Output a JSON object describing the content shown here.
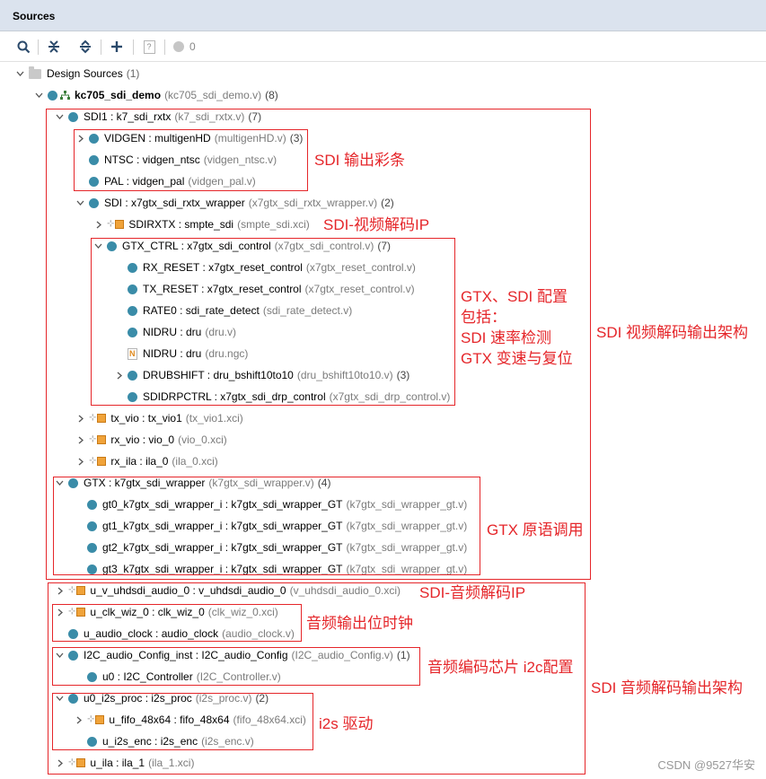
{
  "panel": {
    "title": "Sources"
  },
  "toolbar": {
    "search": "search-icon",
    "collapse_all": "collapse-all-icon",
    "expand_all": "expand-all-icon",
    "add": "add-icon",
    "help": "?",
    "status_count": "0"
  },
  "tree": [
    {
      "id": "design-sources",
      "name": "Design Sources",
      "count": "(1)",
      "expand": "open",
      "icon": "folder"
    },
    {
      "id": "kc705",
      "name": "kc705_sdi_demo",
      "file": "(kc705_sdi_demo.v)",
      "count": "(8)",
      "expand": "open",
      "icon": "dot-hier",
      "bold": true
    },
    {
      "id": "sdi1",
      "name": "SDI1 : k7_sdi_rxtx",
      "file": "(k7_sdi_rxtx.v)",
      "count": "(7)",
      "expand": "open",
      "icon": "dot"
    },
    {
      "id": "vidgen",
      "name": "VIDGEN : multigenHD",
      "file": "(multigenHD.v)",
      "count": "(3)",
      "expand": "closed",
      "icon": "dot"
    },
    {
      "id": "ntsc",
      "name": "NTSC : vidgen_ntsc",
      "file": "(vidgen_ntsc.v)",
      "count": "",
      "expand": "none",
      "icon": "dot"
    },
    {
      "id": "pal",
      "name": "PAL : vidgen_pal",
      "file": "(vidgen_pal.v)",
      "count": "",
      "expand": "none",
      "icon": "dot"
    },
    {
      "id": "sdi",
      "name": "SDI : x7gtx_sdi_rxtx_wrapper",
      "file": "(x7gtx_sdi_rxtx_wrapper.v)",
      "count": "(2)",
      "expand": "open",
      "icon": "dot"
    },
    {
      "id": "sdirxtx",
      "name": "SDIRXTX : smpte_sdi",
      "file": "(smpte_sdi.xci)",
      "count": "",
      "expand": "closed",
      "icon": "ip"
    },
    {
      "id": "gtxctrl",
      "name": "GTX_CTRL : x7gtx_sdi_control",
      "file": "(x7gtx_sdi_control.v)",
      "count": "(7)",
      "expand": "open",
      "icon": "dot"
    },
    {
      "id": "rxreset",
      "name": "RX_RESET : x7gtx_reset_control",
      "file": "(x7gtx_reset_control.v)",
      "count": "",
      "expand": "none",
      "icon": "dot"
    },
    {
      "id": "txreset",
      "name": "TX_RESET : x7gtx_reset_control",
      "file": "(x7gtx_reset_control.v)",
      "count": "",
      "expand": "none",
      "icon": "dot"
    },
    {
      "id": "rate0",
      "name": "RATE0 : sdi_rate_detect",
      "file": "(sdi_rate_detect.v)",
      "count": "",
      "expand": "none",
      "icon": "dot"
    },
    {
      "id": "nidru1",
      "name": "NIDRU : dru",
      "file": "(dru.v)",
      "count": "",
      "expand": "none",
      "icon": "dot"
    },
    {
      "id": "nidru2",
      "name": "NIDRU : dru",
      "file": "(dru.ngc)",
      "count": "",
      "expand": "none",
      "icon": "ngc"
    },
    {
      "id": "drubshift",
      "name": "DRUBSHIFT : dru_bshift10to10",
      "file": "(dru_bshift10to10.v)",
      "count": "(3)",
      "expand": "closed",
      "icon": "dot"
    },
    {
      "id": "sdidrp",
      "name": "SDIDRPCTRL : x7gtx_sdi_drp_control",
      "file": "(x7gtx_sdi_drp_control.v)",
      "count": "",
      "expand": "none",
      "icon": "dot"
    },
    {
      "id": "txvio",
      "name": "tx_vio : tx_vio1",
      "file": "(tx_vio1.xci)",
      "count": "",
      "expand": "closed",
      "icon": "ip"
    },
    {
      "id": "rxvio",
      "name": "rx_vio : vio_0",
      "file": "(vio_0.xci)",
      "count": "",
      "expand": "closed",
      "icon": "ip"
    },
    {
      "id": "rxila",
      "name": "rx_ila : ila_0",
      "file": "(ila_0.xci)",
      "count": "",
      "expand": "closed",
      "icon": "ip"
    },
    {
      "id": "gtx",
      "name": "GTX : k7gtx_sdi_wrapper",
      "file": "(k7gtx_sdi_wrapper.v)",
      "count": "(4)",
      "expand": "open",
      "icon": "dot"
    },
    {
      "id": "gt0",
      "name": "gt0_k7gtx_sdi_wrapper_i : k7gtx_sdi_wrapper_GT",
      "file": "(k7gtx_sdi_wrapper_gt.v)",
      "count": "",
      "expand": "none",
      "icon": "dot"
    },
    {
      "id": "gt1",
      "name": "gt1_k7gtx_sdi_wrapper_i : k7gtx_sdi_wrapper_GT",
      "file": "(k7gtx_sdi_wrapper_gt.v)",
      "count": "",
      "expand": "none",
      "icon": "dot"
    },
    {
      "id": "gt2",
      "name": "gt2_k7gtx_sdi_wrapper_i : k7gtx_sdi_wrapper_GT",
      "file": "(k7gtx_sdi_wrapper_gt.v)",
      "count": "",
      "expand": "none",
      "icon": "dot"
    },
    {
      "id": "gt3",
      "name": "gt3_k7gtx_sdi_wrapper_i : k7gtx_sdi_wrapper_GT",
      "file": "(k7gtx_sdi_wrapper_gt.v)",
      "count": "",
      "expand": "none",
      "icon": "dot"
    },
    {
      "id": "uhdsdi",
      "name": "u_v_uhdsdi_audio_0 : v_uhdsdi_audio_0",
      "file": "(v_uhdsdi_audio_0.xci)",
      "count": "",
      "expand": "closed",
      "icon": "ip"
    },
    {
      "id": "clkwiz",
      "name": "u_clk_wiz_0 : clk_wiz_0",
      "file": "(clk_wiz_0.xci)",
      "count": "",
      "expand": "closed",
      "icon": "ip"
    },
    {
      "id": "audioclk",
      "name": "u_audio_clock : audio_clock",
      "file": "(audio_clock.v)",
      "count": "",
      "expand": "none",
      "icon": "dot"
    },
    {
      "id": "i2ccfg",
      "name": "I2C_audio_Config_inst : I2C_audio_Config",
      "file": "(I2C_audio_Config.v)",
      "count": "(1)",
      "expand": "open",
      "icon": "dot"
    },
    {
      "id": "i2cctrl",
      "name": "u0 : I2C_Controller",
      "file": "(I2C_Controller.v)",
      "count": "",
      "expand": "none",
      "icon": "dot"
    },
    {
      "id": "i2sproc",
      "name": "u0_i2s_proc : i2s_proc",
      "file": "(i2s_proc.v)",
      "count": "(2)",
      "expand": "open",
      "icon": "dot"
    },
    {
      "id": "fifo",
      "name": "u_fifo_48x64 : fifo_48x64",
      "file": "(fifo_48x64.xci)",
      "count": "",
      "expand": "closed",
      "icon": "ip"
    },
    {
      "id": "i2senc",
      "name": "u_i2s_enc : i2s_enc",
      "file": "(i2s_enc.v)",
      "count": "",
      "expand": "none",
      "icon": "dot"
    },
    {
      "id": "uila",
      "name": "u_ila : ila_1",
      "file": "(ila_1.xci)",
      "count": "",
      "expand": "closed",
      "icon": "ip"
    }
  ],
  "annotations": {
    "sdi_colorbar": "SDI 输出彩条",
    "sdi_video_ip": "SDI-视频解码IP",
    "gtx_sdi_config_1": "GTX、SDI 配置",
    "gtx_sdi_config_2": "包括：",
    "gtx_sdi_config_3": "SDI 速率检测",
    "gtx_sdi_config_4": "GTX 变速与复位",
    "sdi_video_arch": "SDI 视频解码输出架构",
    "gtx_primitive": "GTX 原语调用",
    "sdi_audio_ip": "SDI-音频解码IP",
    "audio_bit_clock": "音频输出位时钟",
    "audio_codec_i2c": "音频编码芯片 i2c配置",
    "sdi_audio_arch": "SDI 音频解码输出架构",
    "i2s_driver": "i2s 驱动"
  },
  "watermark": "CSDN @9527华安",
  "colors": {
    "accent_dot": "#3a8ca8",
    "annotation_red": "#e5262a",
    "header_bg": "#dbe3ee",
    "ip_orange": "#f0a33a"
  }
}
